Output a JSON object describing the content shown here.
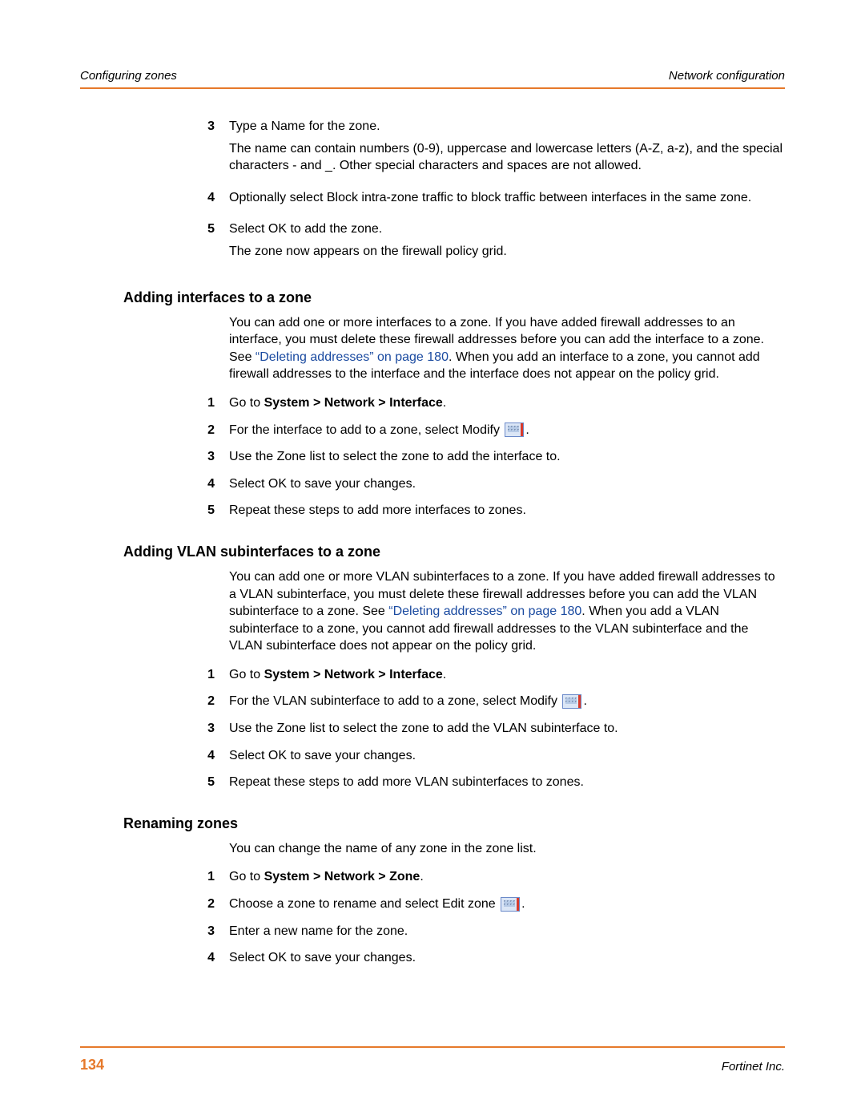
{
  "header": {
    "left": "Configuring zones",
    "right": "Network configuration"
  },
  "top_steps": [
    {
      "num": "3",
      "paras": [
        "Type a Name for the zone.",
        "The name can contain numbers (0-9), uppercase and lowercase letters (A-Z, a-z), and the special characters - and _. Other special characters and spaces are not allowed."
      ]
    },
    {
      "num": "4",
      "paras": [
        "Optionally select Block intra-zone traffic to block traffic between interfaces in the same zone."
      ]
    },
    {
      "num": "5",
      "paras": [
        "Select OK to add the zone.",
        "The zone now appears on the firewall policy grid."
      ]
    }
  ],
  "sec1": {
    "title": "Adding interfaces to a zone",
    "intro_pre": "You can add one or more interfaces to a zone. If you have added firewall addresses to an interface, you must delete these firewall addresses before you can add the interface to a zone. See ",
    "intro_link": "“Deleting addresses” on page 180",
    "intro_post": ". When you add an interface to a zone, you cannot add firewall addresses to the interface and the interface does not appear on the policy grid.",
    "steps": {
      "s1": {
        "num": "1",
        "pre": "Go to ",
        "bold": "System > Network > Interface",
        "post": "."
      },
      "s2": {
        "num": "2",
        "pre": "For the interface to add to a zone, select Modify ",
        "post": "."
      },
      "s3": {
        "num": "3",
        "text": "Use the Zone list to select the zone to add the interface to."
      },
      "s4": {
        "num": "4",
        "text": "Select OK to save your changes."
      },
      "s5": {
        "num": "5",
        "text": "Repeat these steps to add more interfaces to zones."
      }
    }
  },
  "sec2": {
    "title": "Adding VLAN subinterfaces to a zone",
    "intro_pre": "You can add one or more VLAN subinterfaces to a zone. If you have added firewall addresses to a VLAN subinterface, you must delete these firewall addresses before you can add the VLAN subinterface to a zone. See ",
    "intro_link": "“Deleting addresses” on page 180",
    "intro_post": ". When you add a VLAN subinterface to a zone, you cannot add firewall addresses to the VLAN subinterface and the VLAN subinterface does not appear on the policy grid.",
    "steps": {
      "s1": {
        "num": "1",
        "pre": "Go to ",
        "bold": "System > Network > Interface",
        "post": "."
      },
      "s2": {
        "num": "2",
        "pre": "For the VLAN subinterface to add to a zone, select Modify ",
        "post": "."
      },
      "s3": {
        "num": "3",
        "text": "Use the Zone list to select the zone to add the VLAN subinterface to."
      },
      "s4": {
        "num": "4",
        "text": "Select OK to save your changes."
      },
      "s5": {
        "num": "5",
        "text": "Repeat these steps to add more VLAN subinterfaces to zones."
      }
    }
  },
  "sec3": {
    "title": "Renaming zones",
    "intro": "You can change the name of any zone in the zone list.",
    "steps": {
      "s1": {
        "num": "1",
        "pre": "Go to ",
        "bold": "System > Network > Zone",
        "post": "."
      },
      "s2": {
        "num": "2",
        "pre": "Choose a zone to rename and select Edit zone ",
        "post": "."
      },
      "s3": {
        "num": "3",
        "text": "Enter a new name for the zone."
      },
      "s4": {
        "num": "4",
        "text": "Select OK to save your changes."
      }
    }
  },
  "footer": {
    "page": "134",
    "right": "Fortinet Inc."
  }
}
